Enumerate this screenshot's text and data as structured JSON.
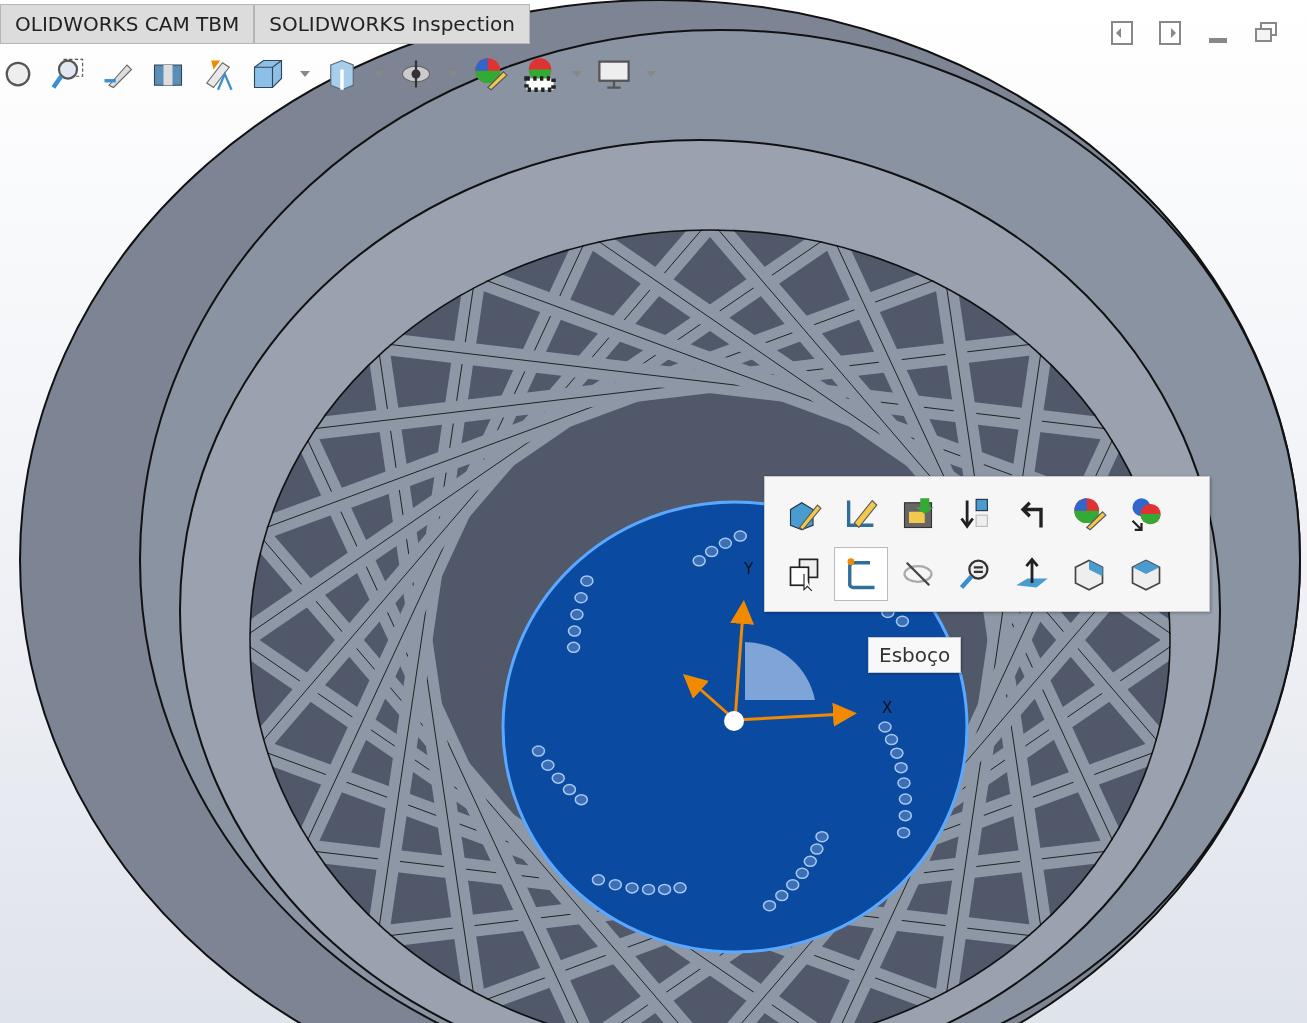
{
  "tabs": [
    {
      "label": "OLIDWORKS CAM TBM",
      "selected": false
    },
    {
      "label": "SOLIDWORKS Inspection",
      "selected": false
    }
  ],
  "context_toolbar": {
    "buttons": [
      {
        "selected": false
      },
      {
        "selected": false
      },
      {
        "selected": false
      },
      {
        "selected": false
      },
      {
        "selected": false
      },
      {
        "selected": false
      },
      {
        "selected": false
      },
      {
        "selected": false
      },
      {
        "selected": true
      },
      {
        "selected": false
      },
      {
        "selected": false
      },
      {
        "selected": false
      },
      {
        "selected": false
      },
      {
        "selected": false
      }
    ]
  },
  "tooltip": {
    "text": "Esboço"
  },
  "triad": {
    "y_label": "Y",
    "x_label": "X"
  }
}
